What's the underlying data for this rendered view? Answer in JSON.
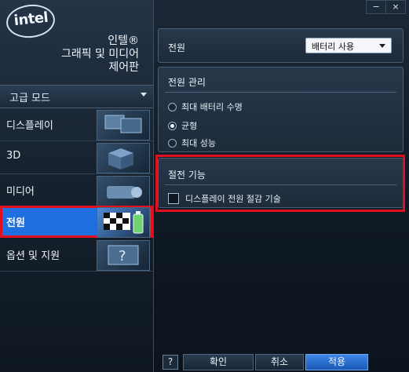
{
  "window": {
    "minimize": "−",
    "close": "×"
  },
  "brand": {
    "logo_text": "intel",
    "line1": "인텔®",
    "line2": "그래픽 및 미디어",
    "line3": "제어판"
  },
  "mode": {
    "label": "고급 모드"
  },
  "nav": {
    "items": [
      {
        "label": "디스플레이",
        "icon": "monitor-icon"
      },
      {
        "label": "3D",
        "icon": "cube-icon"
      },
      {
        "label": "미디어",
        "icon": "projector-icon"
      },
      {
        "label": "전원",
        "icon": "checkered-flag-battery-icon",
        "selected": true
      },
      {
        "label": "옵션 및 지원",
        "icon": "help-screen-icon"
      }
    ]
  },
  "power": {
    "label": "전원",
    "selected_value": "배터리 사용"
  },
  "power_mgmt": {
    "title": "전원 관리",
    "options": [
      "최대 배터리 수명",
      "균형",
      "최대 성능"
    ],
    "selected": "균형"
  },
  "power_saving": {
    "title": "절전 기능",
    "checkbox_label": "디스플레이 전원 절감 기술",
    "checked": false
  },
  "buttons": {
    "help": "?",
    "ok": "확인",
    "cancel": "취소",
    "apply": "적용"
  },
  "colors": {
    "accent": "#1f6fe0",
    "highlight": "#e2101e"
  }
}
